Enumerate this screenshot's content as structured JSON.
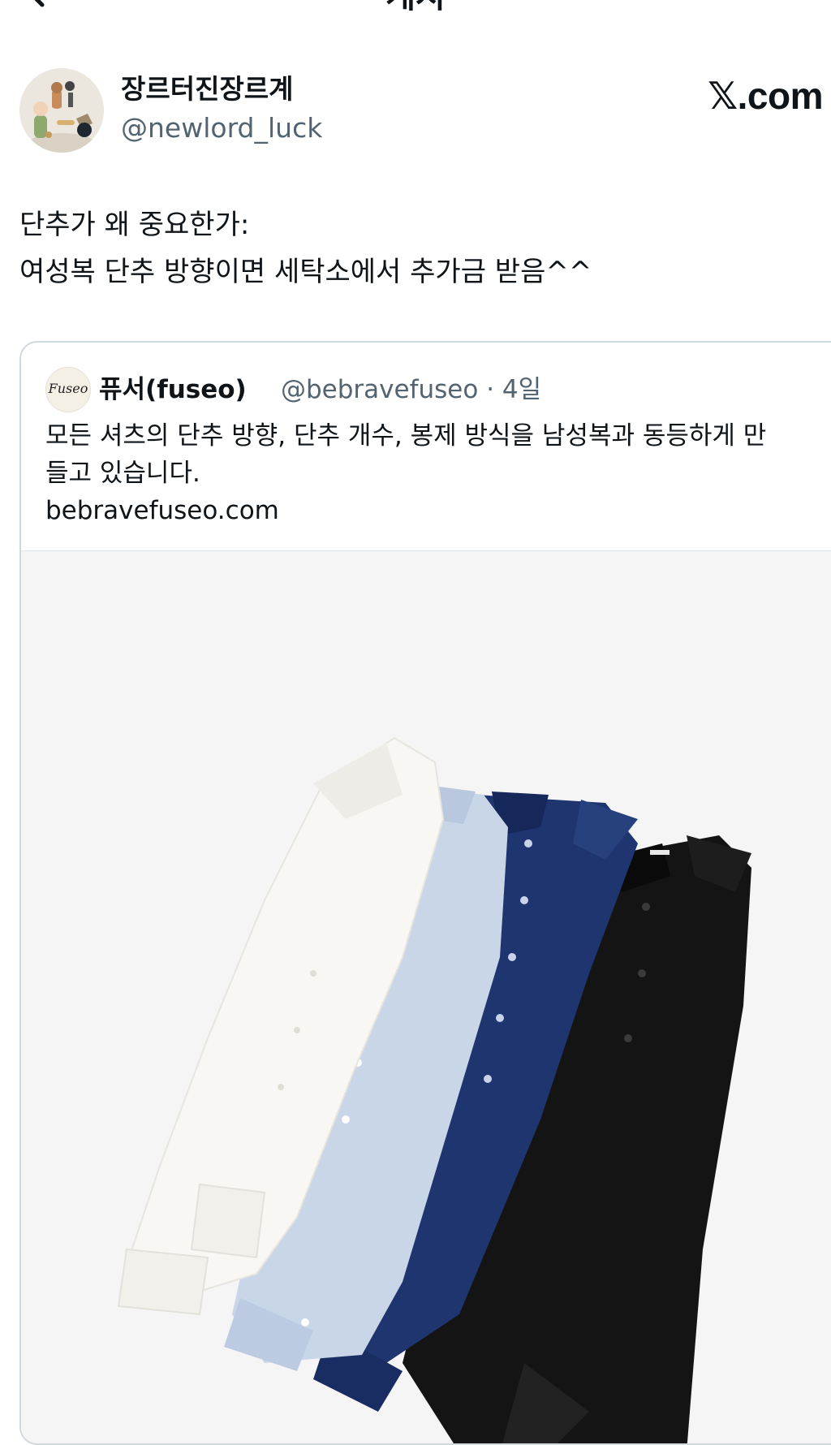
{
  "nav": {
    "title": "게시",
    "back_icon": "arrow-left-icon"
  },
  "author": {
    "display_name": "장르터진장르계",
    "handle": "@newlord_luck",
    "avatar_icon": "cartoon-avatar"
  },
  "brand": {
    "label": "𝕏.com"
  },
  "tweet": {
    "lines": [
      "단추가 왜 중요한가:",
      "여성복 단추 방향이면 세탁소에서 추가금 받음^^"
    ]
  },
  "quote": {
    "avatar_text": "Fuseo",
    "display_name": "퓨서(fuseo)",
    "handle_time": "@bebravefuseo · 4일",
    "lines": [
      "모든 셔츠의 단추 방향, 단추 개수, 봉제 방식을 남성복과 동등하게 만",
      "들고 있습니다."
    ],
    "link": "bebravefuseo.com",
    "image_colors": {
      "white": "#f8f7f3",
      "light_blue": "#c9d6e8",
      "navy": "#1f3570",
      "black": "#141414"
    }
  }
}
